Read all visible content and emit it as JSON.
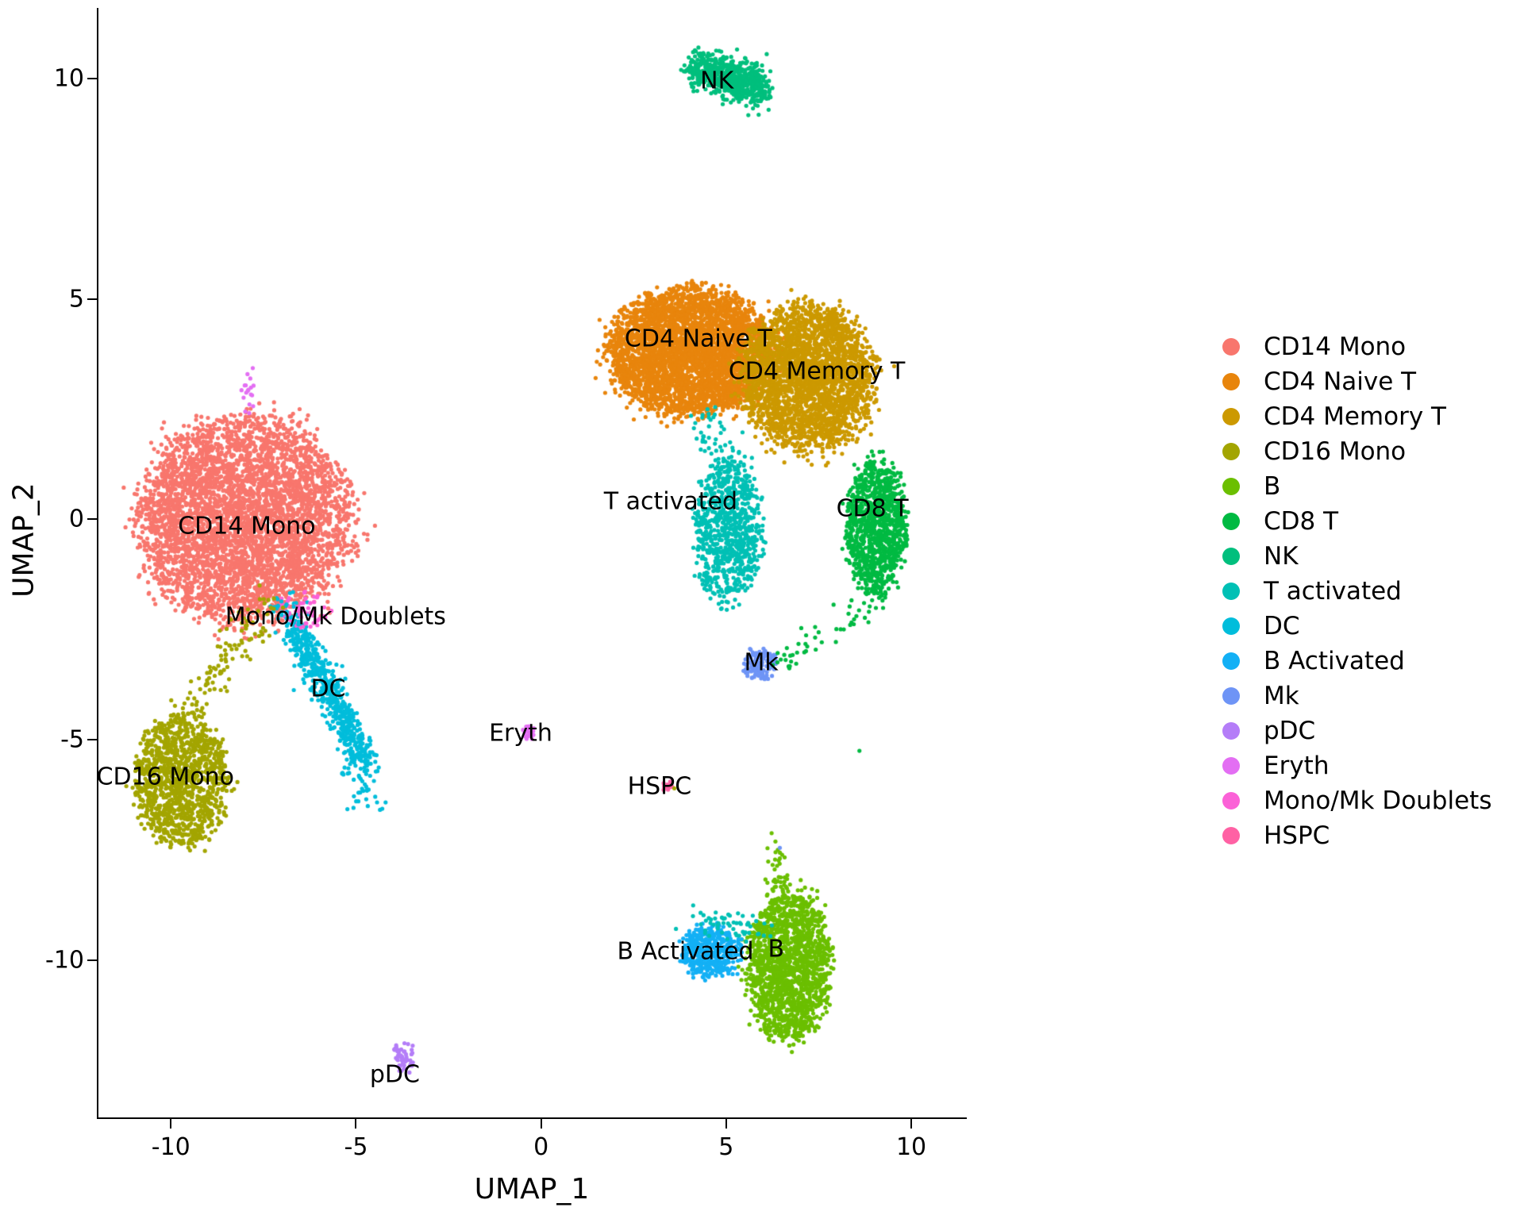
{
  "chart_data": {
    "type": "scatter",
    "title": "",
    "xlabel": "UMAP_1",
    "ylabel": "UMAP_2",
    "xlim": [
      -12.0,
      11.5
    ],
    "ylim": [
      -13.6,
      11.6
    ],
    "xticks": [
      "-10",
      "-5",
      "0",
      "5",
      "10"
    ],
    "xtick_values": [
      -10,
      -5,
      0,
      5,
      10
    ],
    "yticks": [
      "10",
      "5",
      "0",
      "-5",
      "-10"
    ],
    "ytick_values": [
      10,
      5,
      0,
      -5,
      -10
    ],
    "grid": false,
    "legend_position": "right",
    "point_size": 5,
    "series": [
      {
        "name": "CD14 Mono",
        "color": "#F8766D",
        "n_points": 4600,
        "center": [
          -8.0,
          0.0
        ],
        "spread": [
          1.9,
          1.55
        ],
        "shape": "blob",
        "annotation": {
          "text": "CD14 Mono",
          "x": -7.95,
          "y": -0.15
        }
      },
      {
        "name": "CD4 Naive T",
        "color": "#E8850C",
        "n_points": 4000,
        "center": [
          4.05,
          3.8
        ],
        "spread": [
          1.5,
          0.95
        ],
        "shape": "blob",
        "annotation": {
          "text": "CD4 Naive T",
          "x": 4.25,
          "y": 4.1
        }
      },
      {
        "name": "CD4 Memory T",
        "color": "#CC9900",
        "n_points": 2900,
        "center": [
          7.2,
          3.2
        ],
        "spread": [
          1.2,
          1.1
        ],
        "shape": "blob",
        "annotation": {
          "text": "CD4 Memory T",
          "x": 7.45,
          "y": 3.35
        }
      },
      {
        "name": "CD16 Mono",
        "color": "#A3A500",
        "n_points": 1250,
        "center": [
          -9.7,
          -5.9
        ],
        "spread": [
          0.85,
          1.0
        ],
        "shape": "blob",
        "annotation": {
          "text": "CD16 Mono",
          "x": -10.15,
          "y": -5.85
        }
      },
      {
        "name": "B",
        "color": "#6BBF00",
        "n_points": 1700,
        "center": [
          6.7,
          -10.1
        ],
        "spread": [
          0.75,
          1.15
        ],
        "shape": "blob",
        "annotation": {
          "text": "B",
          "x": 6.35,
          "y": -9.75
        }
      },
      {
        "name": "CD8 T",
        "color": "#00BA42",
        "n_points": 1050,
        "center": [
          9.05,
          -0.2
        ],
        "spread": [
          0.55,
          1.05
        ],
        "shape": "blob",
        "annotation": {
          "text": "CD8 T",
          "x": 8.95,
          "y": 0.25
        }
      },
      {
        "name": "NK",
        "color": "#00BF7D",
        "n_points": 700,
        "center": [
          5.2,
          10.0
        ],
        "spread": [
          0.6,
          0.35
        ],
        "shape": "elongated",
        "annotation": {
          "text": "NK",
          "x": 4.75,
          "y": 9.95
        }
      },
      {
        "name": "T activated",
        "color": "#00C0B5",
        "n_points": 800,
        "center": [
          5.05,
          -0.3
        ],
        "spread": [
          0.6,
          1.1
        ],
        "shape": "blob",
        "annotation": {
          "text": "T activated",
          "x": 3.5,
          "y": 0.4
        }
      },
      {
        "name": "DC",
        "color": "#00BDDB",
        "n_points": 520,
        "center": [
          -5.7,
          -3.9
        ],
        "spread": [
          0.75,
          1.1
        ],
        "shape": "streak",
        "annotation": {
          "text": "DC",
          "x": -5.75,
          "y": -3.85
        }
      },
      {
        "name": "B Activated",
        "color": "#13B0F5",
        "n_points": 430,
        "center": [
          4.6,
          -9.8
        ],
        "spread": [
          0.55,
          0.4
        ],
        "shape": "blob",
        "annotation": {
          "text": "B Activated",
          "x": 3.9,
          "y": -9.8
        }
      },
      {
        "name": "Mk",
        "color": "#6E94F6",
        "n_points": 130,
        "center": [
          5.9,
          -3.3
        ],
        "spread": [
          0.3,
          0.25
        ],
        "shape": "blob",
        "annotation": {
          "text": "Mk",
          "x": 5.95,
          "y": -3.25
        }
      },
      {
        "name": "pDC",
        "color": "#B47DF8",
        "n_points": 55,
        "center": [
          -3.7,
          -12.2
        ],
        "spread": [
          0.22,
          0.24
        ],
        "shape": "blob",
        "annotation": {
          "text": "pDC",
          "x": -3.95,
          "y": -12.6
        }
      },
      {
        "name": "Eryth",
        "color": "#E36EF3",
        "n_points": 28,
        "center": [
          -0.35,
          -4.85
        ],
        "spread": [
          0.12,
          0.12
        ],
        "shape": "blob",
        "annotation": {
          "text": "Eryth",
          "x": -0.55,
          "y": -4.85
        }
      },
      {
        "name": "Mono/Mk Doublets",
        "color": "#FB61D7",
        "n_points": 60,
        "center": [
          -6.4,
          -2.05
        ],
        "spread": [
          0.45,
          0.3
        ],
        "shape": "blob",
        "annotation": {
          "text": "Mono/Mk Doublets",
          "x": -5.55,
          "y": -2.2
        }
      },
      {
        "name": "HSPC",
        "color": "#FF61A4",
        "n_points": 14,
        "center": [
          3.45,
          -6.05
        ],
        "spread": [
          0.1,
          0.1
        ],
        "shape": "blob",
        "annotation": {
          "text": "HSPC",
          "x": 3.2,
          "y": -6.05
        }
      }
    ]
  },
  "legend": {
    "items": [
      {
        "label": "CD14 Mono",
        "color": "#F8766D"
      },
      {
        "label": "CD4 Naive T",
        "color": "#E8850C"
      },
      {
        "label": "CD4 Memory T",
        "color": "#CC9900"
      },
      {
        "label": "CD16 Mono",
        "color": "#A3A500"
      },
      {
        "label": "B",
        "color": "#6BBF00"
      },
      {
        "label": "CD8 T",
        "color": "#00BA42"
      },
      {
        "label": "NK",
        "color": "#00BF7D"
      },
      {
        "label": "T activated",
        "color": "#00C0B5"
      },
      {
        "label": "DC",
        "color": "#00BDDB"
      },
      {
        "label": "B Activated",
        "color": "#13B0F5"
      },
      {
        "label": "Mk",
        "color": "#6E94F6"
      },
      {
        "label": "pDC",
        "color": "#B47DF8"
      },
      {
        "label": "Eryth",
        "color": "#E36EF3"
      },
      {
        "label": "Mono/Mk Doublets",
        "color": "#FB61D7"
      },
      {
        "label": "HSPC",
        "color": "#FF61A4"
      }
    ]
  }
}
